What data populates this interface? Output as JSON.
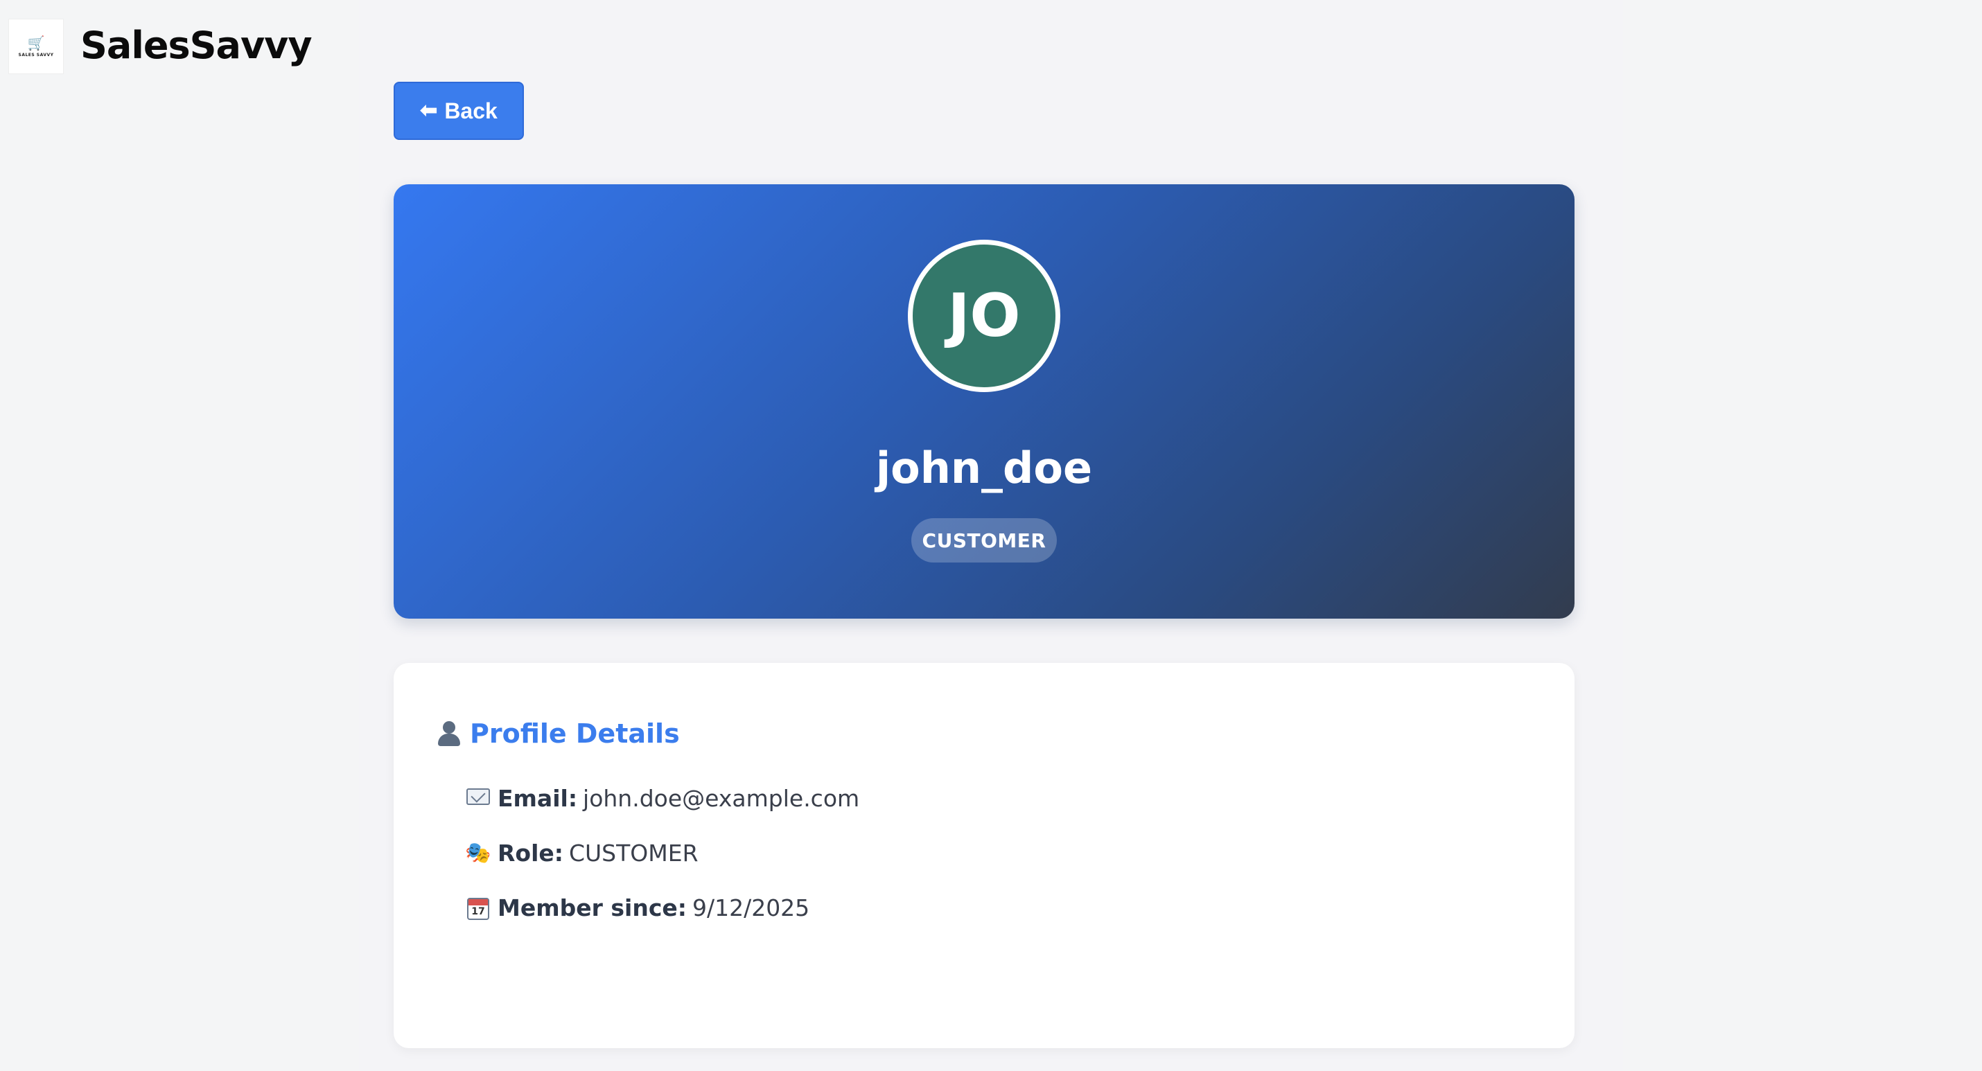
{
  "app": {
    "brand_name": "SalesSavvy",
    "logo_text": "SALES SAVVY",
    "logo_icon": "shopping-cart-icon"
  },
  "toolbar": {
    "back_label": "Back",
    "back_icon": "arrow-left-icon"
  },
  "profile": {
    "avatar_initials": "JO",
    "avatar_color": "#33786a",
    "username": "john_doe",
    "role_badge": "CUSTOMER"
  },
  "details": {
    "title": "Profile Details",
    "title_icon": "person-icon",
    "email_label": "Email:",
    "email_value": "john.doe@example.com",
    "role_label": "Role:",
    "role_value": "CUSTOMER",
    "member_label": "Member since:",
    "member_value": "9/12/2025",
    "calendar_day": "17"
  },
  "colors": {
    "accent": "#3b7ded",
    "hero_gradient_start": "#3578f0",
    "hero_gradient_end": "#323c4e"
  }
}
